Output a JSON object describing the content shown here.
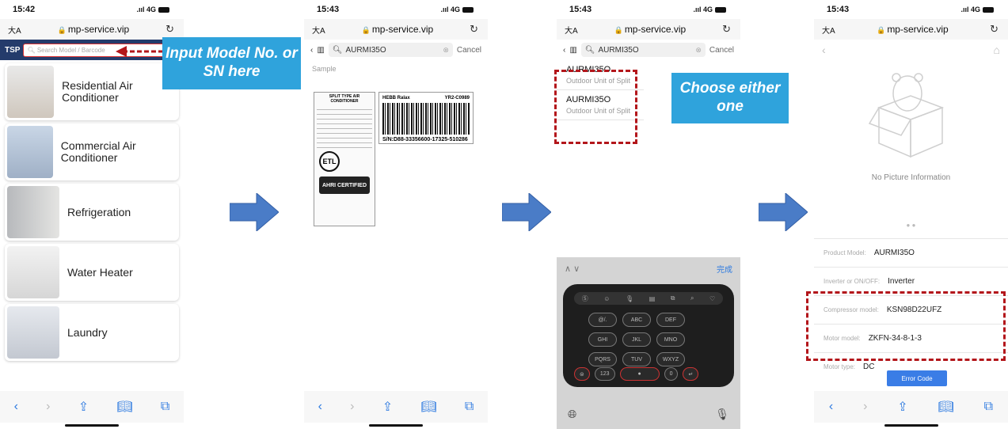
{
  "phone1": {
    "time": "15:42",
    "signal": ".ııl 4G",
    "aa": "大A",
    "url": "mp-service.vip",
    "brand": "TSP",
    "search_placeholder": "Search Model / Barcode",
    "categories": [
      {
        "label": "Residential Air Conditioner"
      },
      {
        "label": "Commercial Air Conditioner"
      },
      {
        "label": "Refrigeration"
      },
      {
        "label": "Water Heater"
      },
      {
        "label": "Laundry"
      }
    ]
  },
  "phone2": {
    "time": "15:43",
    "signal": ".ııl 4G",
    "aa": "大A",
    "url": "mp-service.vip",
    "search_value": "AURMI35O",
    "cancel": "Cancel",
    "sample_label": "Sample",
    "label_title": "SPLIT TYPE AIR CONDITIONER",
    "barcode_brand": "HEBB Ralax",
    "barcode_code": "YR2-C0989",
    "barcode_sn": "S/N:D88-33356600-17325-510286",
    "ahri_text": "AHRI CERTIFIED",
    "etl_text": "ETL"
  },
  "phone3": {
    "time": "15:43",
    "signal": ".ııl 4G",
    "aa": "大A",
    "url": "mp-service.vip",
    "search_value": "AURMI35O",
    "cancel": "Cancel",
    "results": [
      {
        "model": "AURMI35O",
        "desc": "Outdoor Unit of Split"
      },
      {
        "model": "AURMI35O",
        "desc": "Outdoor Unit of Split"
      }
    ],
    "kb_done": "完成",
    "keys": [
      "@/.",
      "ABC",
      "DEF",
      "GHI",
      "JKL",
      "MNO",
      "PQRS",
      "TUV",
      "WXYZ"
    ],
    "key_123": "123",
    "key_zero": "0"
  },
  "phone4": {
    "time": "15:43",
    "signal": ".ııl 4G",
    "aa": "大A",
    "url": "mp-service.vip",
    "no_picture": "No Picture Information",
    "props": [
      {
        "label": "Product Model:",
        "value": "AURMI35O"
      },
      {
        "label": "Inverter or ON/OFF:",
        "value": "Inverter"
      },
      {
        "label": "Compressor model:",
        "value": "KSN98D22UFZ"
      },
      {
        "label": "Motor model:",
        "value": "ZKFN-34-8-1-3"
      },
      {
        "label": "Motor type:",
        "value": "DC"
      }
    ],
    "error_code": "Error Code"
  },
  "annotations": {
    "callout1": "Input Model No. or SN here",
    "callout2": "Choose either one"
  },
  "colors": {
    "callout": "#2fa3dc",
    "dashed": "#b3161b",
    "arrow": "#4a7cc7"
  }
}
